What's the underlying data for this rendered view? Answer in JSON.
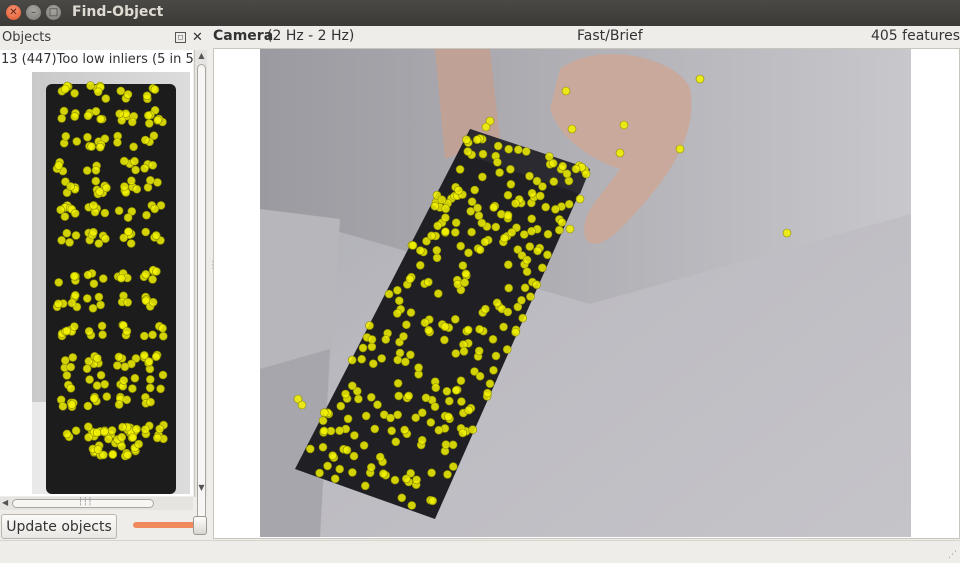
{
  "window": {
    "title": "Find-Object"
  },
  "objects_dock": {
    "title": "Objects",
    "object_label": "13 (447)Too low inliers (5 in 5",
    "update_button": "Update objects",
    "slider_value_fraction": 1.0
  },
  "camera": {
    "title": "Camera",
    "rate": "(2 Hz - 2 Hz)",
    "method": "Fast/Brief",
    "features": "405 features"
  },
  "colors": {
    "feature": "#f2f200",
    "feature_edge": "#8a8a00",
    "accent": "#f08a5d",
    "titlebar": "#3b3a37"
  },
  "icons": {
    "close": "close-icon",
    "minimize": "minimize-icon",
    "maximize": "maximize-icon",
    "float": "float-icon",
    "dock_close": "close-icon"
  }
}
